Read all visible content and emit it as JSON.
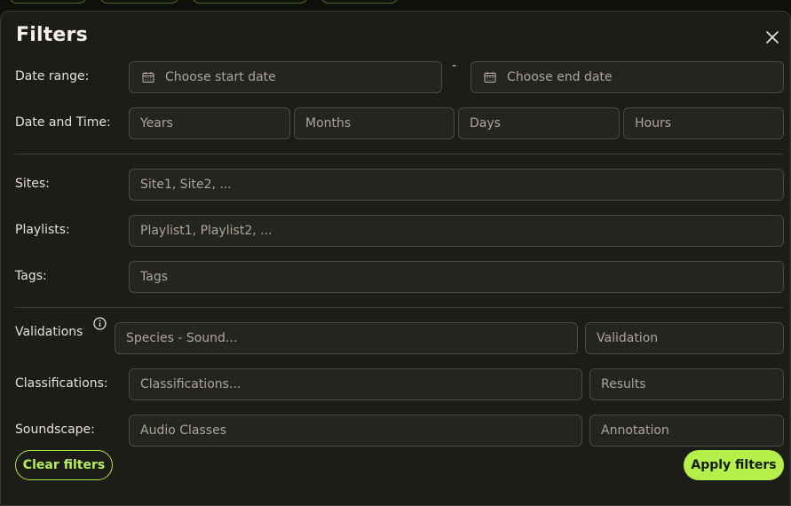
{
  "modal": {
    "title": "Filters"
  },
  "date_range": {
    "label": "Date range:",
    "start_placeholder": "Choose start date",
    "separator": "-",
    "end_placeholder": "Choose end date"
  },
  "date_time": {
    "label": "Date and Time:",
    "years": "Years",
    "months": "Months",
    "days": "Days",
    "hours": "Hours"
  },
  "sites": {
    "label": "Sites:",
    "placeholder": "Site1, Site2, ..."
  },
  "playlists": {
    "label": "Playlists:",
    "placeholder": "Playlist1, Playlist2, ..."
  },
  "tags": {
    "label": "Tags:",
    "placeholder": "Tags"
  },
  "validations": {
    "label": "Validations",
    "species_placeholder": "Species - Sound...",
    "validation_placeholder": "Validation"
  },
  "classifications": {
    "label": "Classifications:",
    "classifications_placeholder": "Classifications...",
    "results_placeholder": "Results"
  },
  "soundscape": {
    "label": "Soundscape:",
    "audio_classes_placeholder": "Audio Classes",
    "annotation_placeholder": "Annotation"
  },
  "actions": {
    "clear_label": "Clear filters",
    "apply_label": "Apply filters"
  },
  "colors": {
    "accent": "#b5f04a",
    "background": "#1d1c19",
    "field": "#25241f"
  },
  "icons": {
    "close": "close-icon",
    "calendar": "calendar-icon",
    "info": "info-icon"
  }
}
